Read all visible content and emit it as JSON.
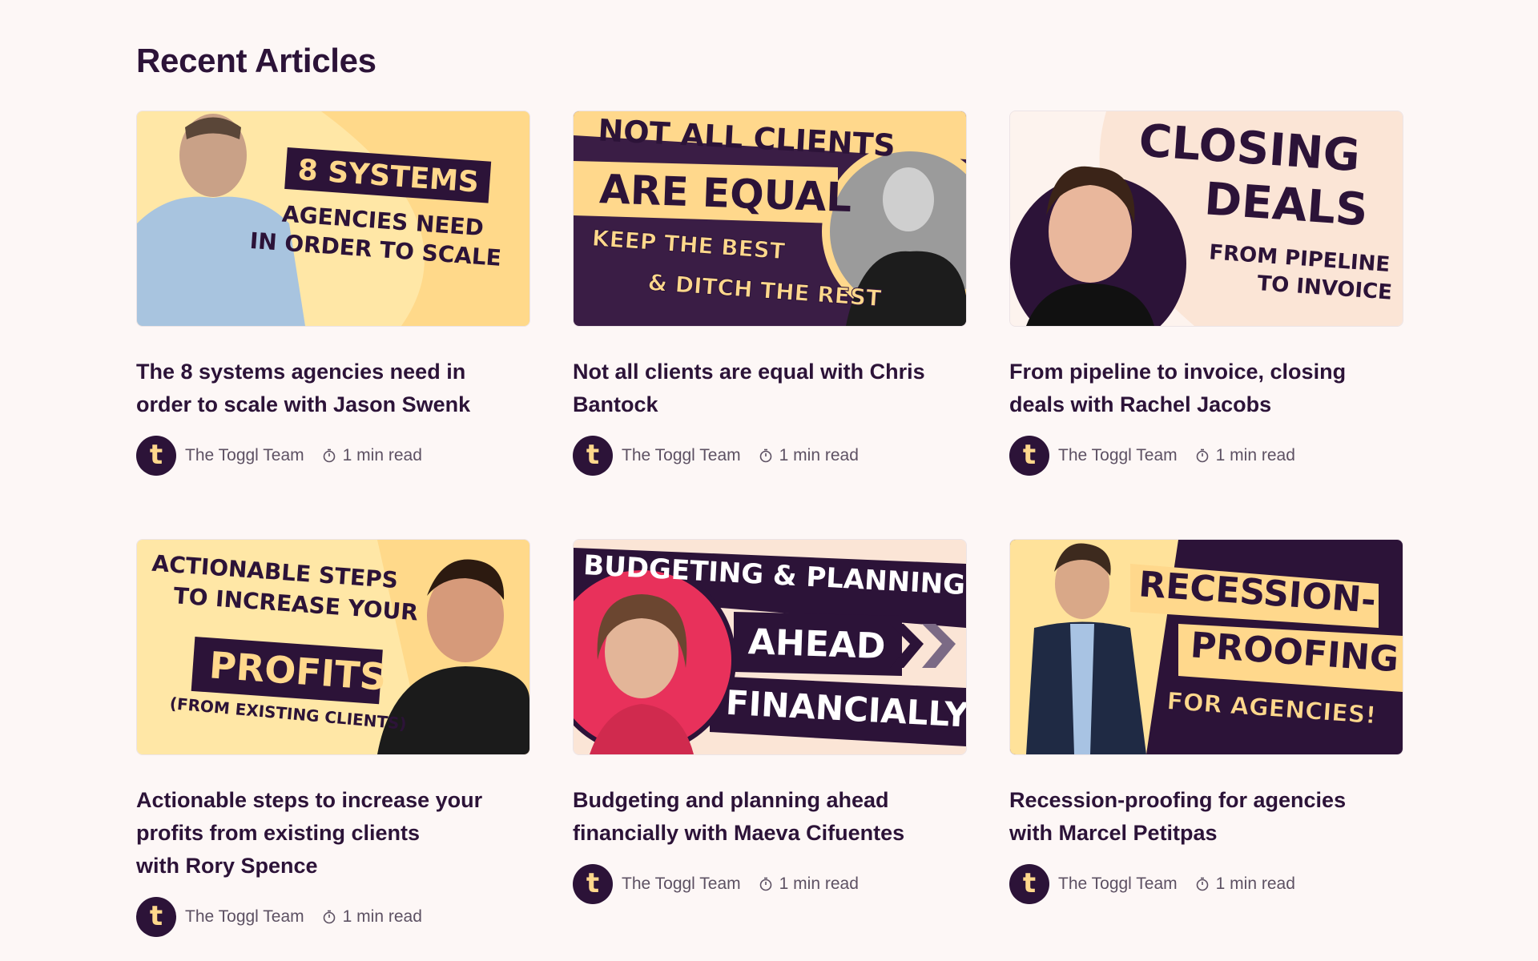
{
  "section": {
    "title": "Recent Articles"
  },
  "colors": {
    "background": "#fdf7f6",
    "dark_purple": "#2c1338",
    "yellow": "#ffd88c",
    "light_peach": "#fbe5d6",
    "pink": "#e8315b"
  },
  "articles": [
    {
      "thumb_lines": [
        "8 SYSTEMS",
        "AGENCIES NEED",
        "IN ORDER TO SCALE"
      ],
      "title_lines": [
        "The 8 systems agencies need in",
        "order to scale with Jason Swenk"
      ],
      "author": "The Toggl Team",
      "read_time": "1 min read",
      "avatar_icon": "toggl-logo-icon"
    },
    {
      "thumb_lines": [
        "NOT ALL CLIENTS",
        "ARE EQUAL",
        "KEEP THE BEST",
        "& DITCH THE REST"
      ],
      "title_lines": [
        "Not all clients are equal with Chris",
        "Bantock"
      ],
      "author": "The Toggl Team",
      "read_time": "1 min read",
      "avatar_icon": "toggl-logo-icon"
    },
    {
      "thumb_lines": [
        "CLOSING",
        "DEALS",
        "FROM PIPELINE",
        "TO INVOICE"
      ],
      "title_lines": [
        "From pipeline to invoice, closing",
        "deals with Rachel Jacobs"
      ],
      "author": "The Toggl Team",
      "read_time": "1 min read",
      "avatar_icon": "toggl-logo-icon"
    },
    {
      "thumb_lines": [
        "ACTIONABLE STEPS",
        "TO INCREASE YOUR",
        "PROFITS",
        "(FROM EXISTING CLIENTS)"
      ],
      "title_lines": [
        "Actionable steps to increase your",
        "profits from existing clients",
        "with Rory Spence"
      ],
      "author": "The Toggl Team",
      "read_time": "1 min read",
      "avatar_icon": "toggl-logo-icon"
    },
    {
      "thumb_lines": [
        "BUDGETING & PLANNING",
        "AHEAD",
        "FINANCIALLY"
      ],
      "title_lines": [
        "Budgeting and planning ahead",
        "financially with Maeva Cifuentes"
      ],
      "author": "The Toggl Team",
      "read_time": "1 min read",
      "avatar_icon": "toggl-logo-icon"
    },
    {
      "thumb_lines": [
        "RECESSION-",
        "PROOFING",
        "FOR AGENCIES!"
      ],
      "title_lines": [
        "Recession-proofing for agencies",
        "with Marcel Petitpas"
      ],
      "author": "The Toggl Team",
      "read_time": "1 min read",
      "avatar_icon": "toggl-logo-icon"
    }
  ],
  "avatar_letter": "t",
  "icons": {
    "clock": "stopwatch-icon"
  }
}
